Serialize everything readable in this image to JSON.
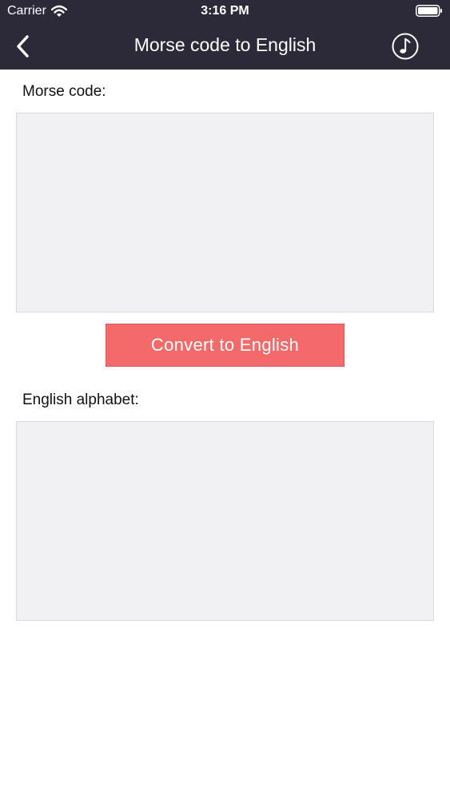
{
  "status_bar": {
    "carrier": "Carrier",
    "time": "3:16 PM"
  },
  "nav": {
    "title": "Morse code to English",
    "back_icon": "chevron-left-icon",
    "sound_icon": "music-note-icon"
  },
  "input_section": {
    "label": "Morse code:",
    "value": ""
  },
  "convert_button": {
    "label": "Convert to English"
  },
  "output_section": {
    "label": "English alphabet:",
    "value": ""
  },
  "colors": {
    "nav_background": "#2c2a38",
    "button_background": "#f4696a",
    "text_area_background": "#f1f0f3"
  }
}
